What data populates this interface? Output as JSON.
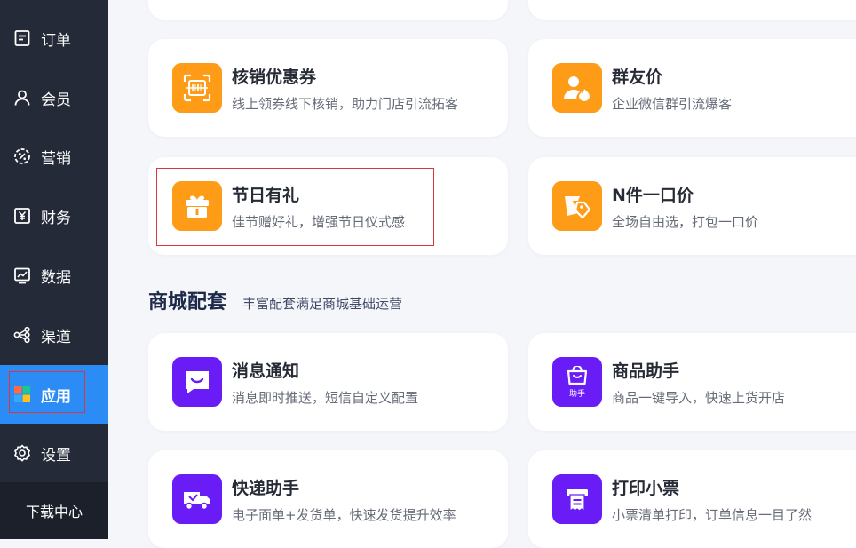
{
  "sidebar": {
    "items": [
      {
        "label": "订单",
        "icon": "order-icon"
      },
      {
        "label": "会员",
        "icon": "user-icon"
      },
      {
        "label": "营销",
        "icon": "marketing-icon"
      },
      {
        "label": "财务",
        "icon": "finance-icon"
      },
      {
        "label": "数据",
        "icon": "data-icon"
      },
      {
        "label": "渠道",
        "icon": "channel-icon"
      },
      {
        "label": "应用",
        "icon": "apps-icon",
        "active": true
      },
      {
        "label": "设置",
        "icon": "settings-icon"
      }
    ],
    "download_label": "下载中心"
  },
  "marketing_cards": [
    {
      "title": "核销优惠券",
      "desc": "线上领券线下核销，助力门店引流拓客",
      "icon": "coupon-scan-icon"
    },
    {
      "title": "群友价",
      "desc": "企业微信群引流爆客",
      "icon": "group-user-icon"
    },
    {
      "title": "节日有礼",
      "desc": "佳节赠好礼，增强节日仪式感",
      "icon": "gift-icon"
    },
    {
      "title": "N件一口价",
      "desc": "全场自由选，打包一口价",
      "icon": "price-tag-icon"
    }
  ],
  "mall_section": {
    "title": "商城配套",
    "subtitle": "丰富配套满足商城基础运营",
    "cards": [
      {
        "title": "消息通知",
        "desc": "消息即时推送，短信自定义配置",
        "icon": "message-icon"
      },
      {
        "title": "商品助手",
        "desc": "商品一键导入，快速上货开店",
        "icon": "shopping-bag-icon",
        "badge": "助手"
      },
      {
        "title": "快递助手",
        "desc": "电子面单+发货单，快速发货提升效率",
        "icon": "delivery-truck-icon"
      },
      {
        "title": "打印小票",
        "desc": "小票清单打印，订单信息一目了然",
        "icon": "printer-icon"
      }
    ]
  },
  "colors": {
    "sidebar_bg": "#242a37",
    "active_bg": "#2b8cf6",
    "orange_icon": "#fe9b17",
    "purple_icon": "#6a1cf7",
    "highlight_border": "#d9363e"
  }
}
